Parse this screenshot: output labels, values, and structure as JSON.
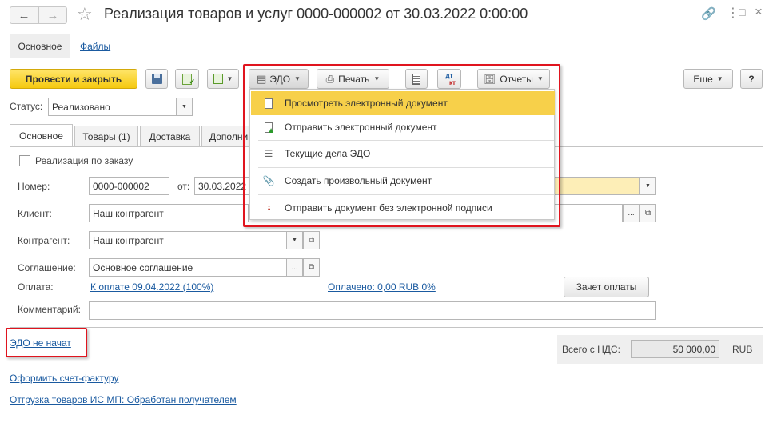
{
  "window": {
    "title": "Реализация товаров и услуг 0000-000002 от 30.03.2022 0:00:00",
    "icons": [
      "arrow-left-icon",
      "arrow-right-icon",
      "star-icon",
      "link-icon",
      "more-icon",
      "maximize-icon",
      "close-icon"
    ]
  },
  "top_tabs": {
    "main": "Основное",
    "files": "Файлы"
  },
  "toolbar": {
    "post_close": "Провести и закрыть",
    "edo": "ЭДО",
    "print": "Печать",
    "reports": "Отчеты",
    "more": "Еще",
    "help": "?",
    "dt_kt_top": "дт",
    "dt_kt_bottom": "кт"
  },
  "edo_menu": {
    "items": [
      {
        "label": "Просмотреть электронный документ",
        "icon": "document-icon",
        "highlighted": true
      },
      {
        "label": "Отправить электронный документ",
        "icon": "send-document-icon"
      },
      {
        "label": "Текущие дела ЭДО",
        "icon": "list-icon"
      },
      {
        "label": "Создать произвольный документ",
        "icon": "paperclip-icon"
      },
      {
        "label": "Отправить документ без электронной подписи",
        "icon": "dots-icon"
      }
    ]
  },
  "status": {
    "label": "Статус:",
    "value": "Реализовано"
  },
  "form_tabs": [
    "Основное",
    "Товары (1)",
    "Доставка",
    "Дополни"
  ],
  "form": {
    "by_order_label": "Реализация по заказу",
    "number_label": "Номер:",
    "number_value": "0000-000002",
    "date_label": "от:",
    "date_value": "30.03.2022",
    "client_label": "Клиент:",
    "client_value": "Наш контрагент",
    "counterparty_label": "Контрагент:",
    "counterparty_value": "Наш контрагент",
    "agreement_label": "Соглашение:",
    "agreement_value": "Основное соглашение",
    "payment_label": "Оплата:",
    "payment_due_link": "К оплате 09.04.2022 (100%)",
    "paid_link": "Оплачено: 0,00 RUB  0%",
    "offset_button": "Зачет оплаты",
    "comment_label": "Комментарий:",
    "comment_value": ""
  },
  "footer": {
    "edo_status_link": "ЭДО не начат",
    "invoice_link": "Оформить счет-фактуру",
    "shipment_link": "Отгрузка товаров ИС МП: Обработан получателем",
    "total_label": "Всего с НДС:",
    "total_value": "50 000,00",
    "currency": "RUB"
  },
  "colors": {
    "accent_yellow": "#f5d23a",
    "highlight_red": "#e0141e",
    "link_blue": "#1a5aa0",
    "menu_highlight": "#f7d04a",
    "yellow_field": "#fdeeb7"
  }
}
